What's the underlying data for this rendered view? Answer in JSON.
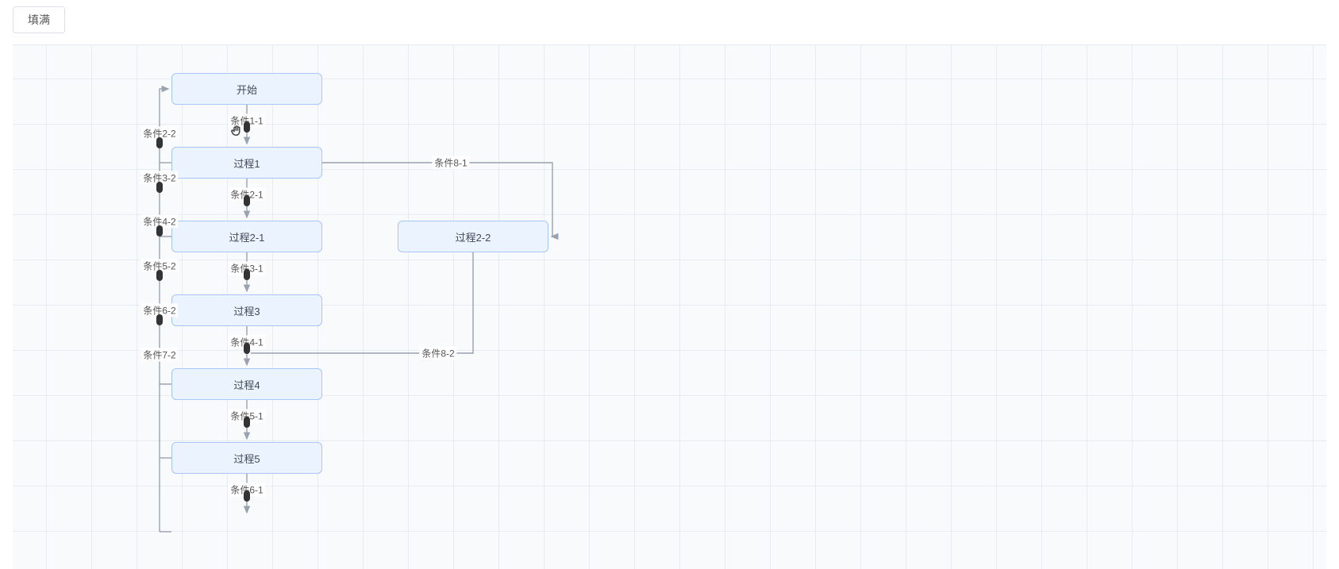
{
  "toolbar": {
    "fill_button": "填满"
  },
  "nodes": {
    "start": {
      "label": "开始"
    },
    "proc1": {
      "label": "过程1"
    },
    "proc2_1": {
      "label": "过程2-1"
    },
    "proc2_2": {
      "label": "过程2-2"
    },
    "proc3": {
      "label": "过程3"
    },
    "proc4": {
      "label": "过程4"
    },
    "proc5": {
      "label": "过程5"
    }
  },
  "edge_labels": {
    "c1_1": "条件1-1",
    "c2_1": "条件2-1",
    "c3_1": "条件3-1",
    "c4_1": "条件4-1",
    "c5_1": "条件5-1",
    "c6_1": "条件6-1",
    "c2_2": "条件2-2",
    "c3_2": "条件3-2",
    "c4_2": "条件4-2",
    "c5_2": "条件5-2",
    "c6_2": "条件6-2",
    "c7_2": "条件7-2",
    "c8_1": "条件8-1",
    "c8_2": "条件8-2"
  },
  "colors": {
    "node_fill": "#eaf3fe",
    "node_border": "#a7c6f5",
    "edge": "#9aa2af"
  }
}
